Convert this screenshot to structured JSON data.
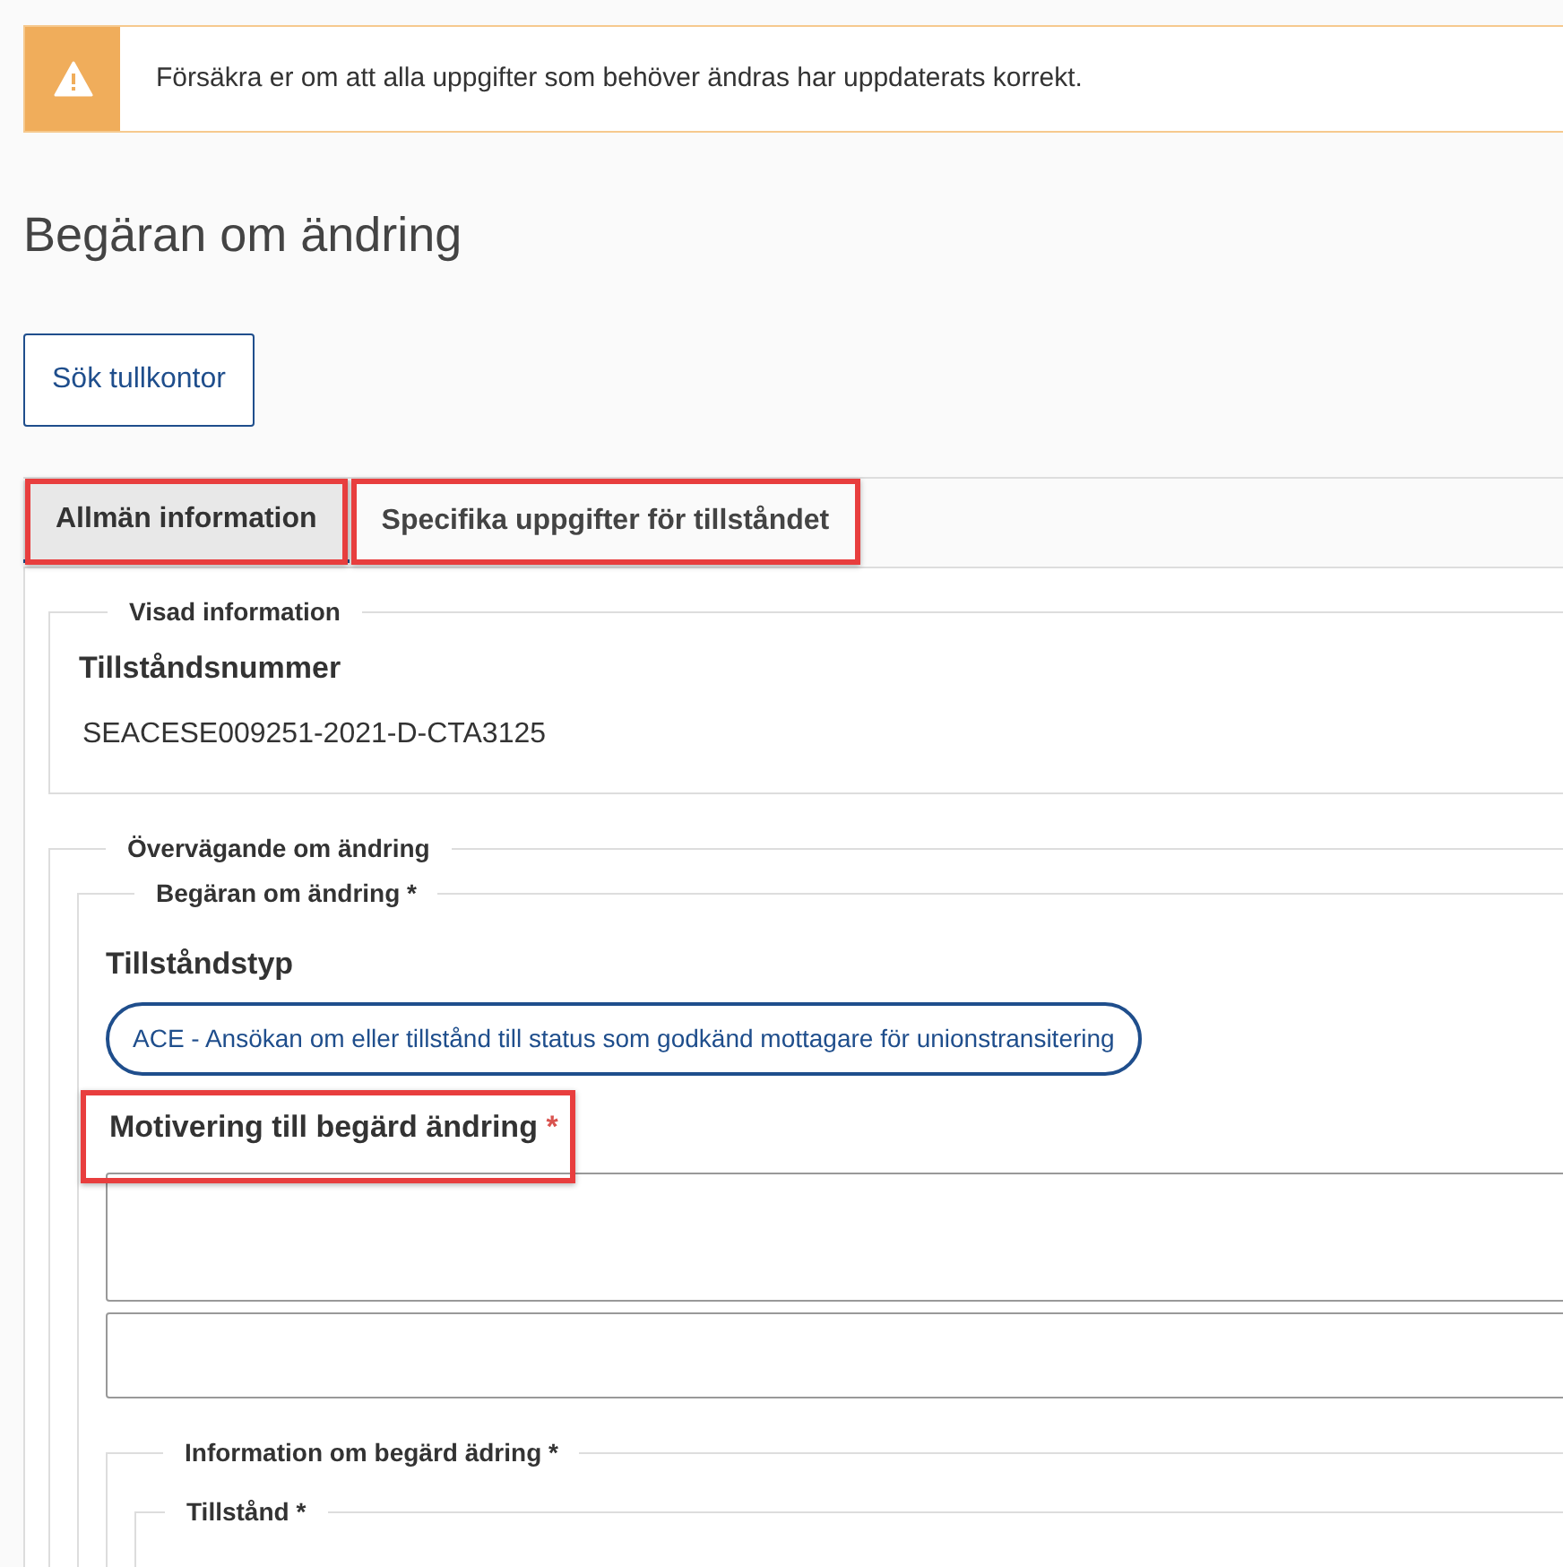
{
  "alert": {
    "kind": "warning",
    "text": "Försäkra er om att alla uppgifter som behöver ändras har uppdaterats korrekt."
  },
  "title": "Begäran om ändring",
  "search_button": "Sök tullkontor",
  "tabs": [
    {
      "label": "Allmän information",
      "selected": true,
      "highlighted": true
    },
    {
      "label": "Specifika uppgifter för tillståndet",
      "selected": false,
      "highlighted": true
    }
  ],
  "shown_info": {
    "legend": "Visad information",
    "label": "Tillståndsnummer",
    "value": "SEACESE009251-2021-D-CTA3125"
  },
  "consideration": {
    "legend": "Övervägande om ändring",
    "request": {
      "legend": "Begäran om ändring *",
      "type_label": "Tillståndstyp",
      "type_value": "ACE - Ansökan om eller tillstånd till status som godkänd mottagare för unionstransitering",
      "motivation": {
        "label": "Motivering till begärd ändring",
        "required_mark": "*",
        "highlighted": true
      }
    },
    "info": {
      "legend": "Information om begärd ädring *",
      "sub_legend": "Tillstånd *"
    }
  }
}
